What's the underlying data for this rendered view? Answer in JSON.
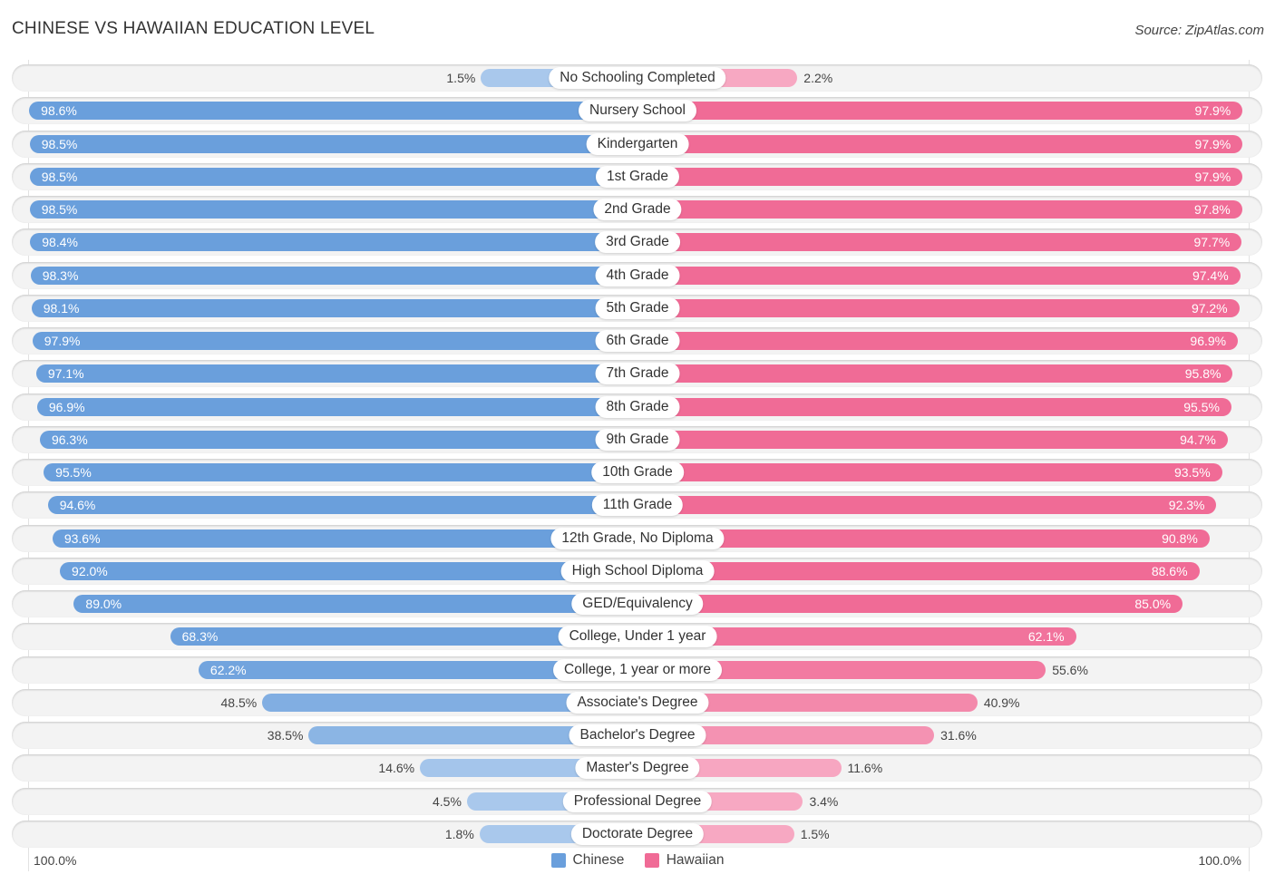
{
  "header": {
    "title": "CHINESE VS HAWAIIAN EDUCATION LEVEL",
    "source": "Source: ZipAtlas.com"
  },
  "colors": {
    "chinese": "#6a9fdc",
    "chinese_light": "#a9c8ec",
    "hawaiian": "#f06b96",
    "hawaiian_light": "#f7a8c2"
  },
  "footer": {
    "left_axis": "100.0%",
    "right_axis": "100.0%"
  },
  "chart_data": {
    "type": "bar",
    "orientation": "horizontal-diverging",
    "title": "CHINESE VS HAWAIIAN EDUCATION LEVEL",
    "xlabel": "",
    "ylabel": "",
    "xlim": [
      0,
      100
    ],
    "legend": {
      "position": "bottom-center",
      "entries": [
        "Chinese",
        "Hawaiian"
      ]
    },
    "categories": [
      "No Schooling Completed",
      "Nursery School",
      "Kindergarten",
      "1st Grade",
      "2nd Grade",
      "3rd Grade",
      "4th Grade",
      "5th Grade",
      "6th Grade",
      "7th Grade",
      "8th Grade",
      "9th Grade",
      "10th Grade",
      "11th Grade",
      "12th Grade, No Diploma",
      "High School Diploma",
      "GED/Equivalency",
      "College, Under 1 year",
      "College, 1 year or more",
      "Associate's Degree",
      "Bachelor's Degree",
      "Master's Degree",
      "Professional Degree",
      "Doctorate Degree"
    ],
    "series": [
      {
        "name": "Chinese",
        "side": "left",
        "values": [
          1.5,
          98.6,
          98.5,
          98.5,
          98.5,
          98.4,
          98.3,
          98.1,
          97.9,
          97.1,
          96.9,
          96.3,
          95.5,
          94.6,
          93.6,
          92.0,
          89.0,
          68.3,
          62.2,
          48.5,
          38.5,
          14.6,
          4.5,
          1.8
        ]
      },
      {
        "name": "Hawaiian",
        "side": "right",
        "values": [
          2.2,
          97.9,
          97.9,
          97.9,
          97.8,
          97.7,
          97.4,
          97.2,
          96.9,
          95.8,
          95.5,
          94.7,
          93.5,
          92.3,
          90.8,
          88.6,
          85.0,
          62.1,
          55.6,
          40.9,
          31.6,
          11.6,
          3.4,
          1.5
        ]
      }
    ]
  }
}
